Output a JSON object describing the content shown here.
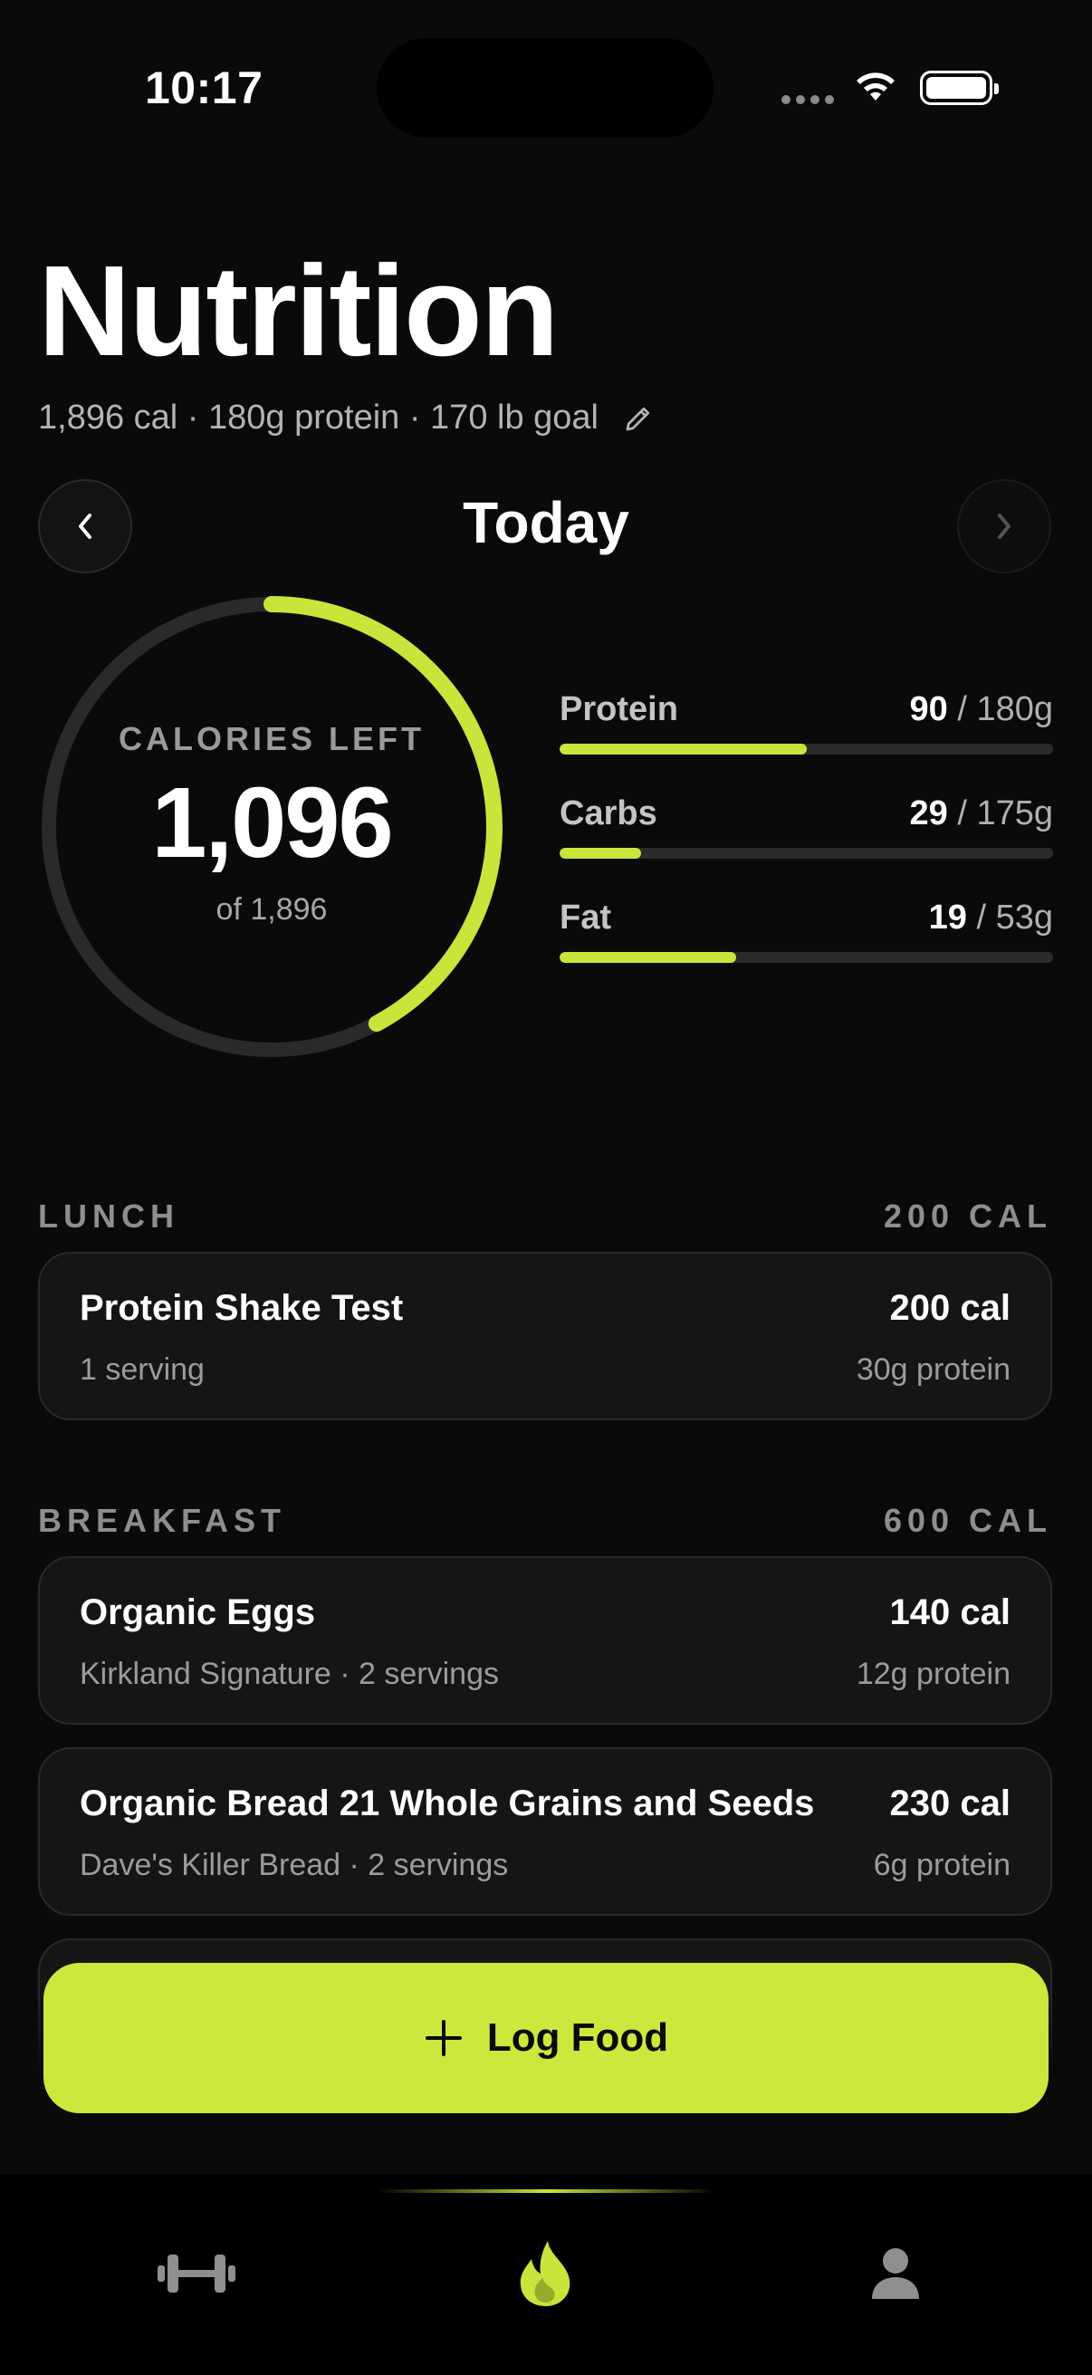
{
  "status": {
    "time": "10:17"
  },
  "header": {
    "title": "Nutrition",
    "subtitle": "1,896 cal · 180g protein · 170 lb goal"
  },
  "day_nav": {
    "label": "Today"
  },
  "calories": {
    "label": "CALORIES LEFT",
    "remaining": "1,096",
    "of": "of 1,896",
    "consumed_fraction": 0.4219
  },
  "macros": [
    {
      "name": "Protein",
      "value": "90",
      "goal": " / 180g",
      "fraction": 0.5
    },
    {
      "name": "Carbs",
      "value": "29",
      "goal": " / 175g",
      "fraction": 0.166
    },
    {
      "name": "Fat",
      "value": "19",
      "goal": " / 53g",
      "fraction": 0.358
    }
  ],
  "sections": [
    {
      "name": "LUNCH",
      "total": "200 CAL",
      "items": [
        {
          "name": "Protein Shake Test",
          "cal": "200 cal",
          "detail": "1 serving",
          "protein": "30g protein"
        }
      ]
    },
    {
      "name": "BREAKFAST",
      "total": "600 CAL",
      "items": [
        {
          "name": "Organic Eggs",
          "cal": "140 cal",
          "detail": "Kirkland Signature · 2 servings",
          "protein": "12g protein"
        },
        {
          "name": "Organic Bread 21 Whole Grains and Seeds",
          "cal": "230 cal",
          "detail": "Dave's Killer Bread · 2 servings",
          "protein": "6g protein"
        }
      ]
    }
  ],
  "log_button": {
    "label": "Log Food",
    "icon": "plus-icon"
  },
  "tabs": [
    {
      "icon": "dumbbell-icon",
      "active": false
    },
    {
      "icon": "flame-icon",
      "active": true
    },
    {
      "icon": "person-icon",
      "active": false
    }
  ],
  "colors": {
    "accent": "#c9e43a",
    "background": "#0b0a0a",
    "card": "#161414",
    "track": "#2b2b2b"
  }
}
